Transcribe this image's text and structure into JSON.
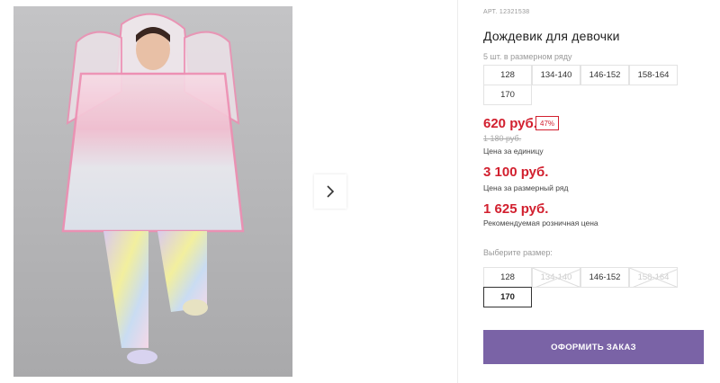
{
  "product": {
    "article": "АРТ. 12321538",
    "title": "Дождевик для девочки",
    "pack_note": "5 шт. в размерном ряду",
    "range_sizes": [
      "128",
      "134-140",
      "146-152",
      "158-164",
      "170"
    ],
    "price": "620 руб.",
    "discount": "47%",
    "old_price": "1 180 руб.",
    "price_caption": "Цена за единицу",
    "range_price": "3 100 руб.",
    "range_caption": "Цена за размерный ряд",
    "retail_price": "1 625 руб.",
    "retail_caption": "Рекомендуемая розничная цена",
    "choose_label": "Выберите размер:",
    "choose_sizes": [
      {
        "label": "128",
        "available": true,
        "selected": false
      },
      {
        "label": "134-140",
        "available": false,
        "selected": false
      },
      {
        "label": "146-152",
        "available": true,
        "selected": false
      },
      {
        "label": "158-164",
        "available": false,
        "selected": false
      },
      {
        "label": "170",
        "available": true,
        "selected": true
      }
    ],
    "order_button": "ОФОРМИТЬ ЗАКАЗ"
  },
  "gallery": {
    "next_icon": "chevron-right-icon",
    "photo": "girl-in-raincoat-photo"
  },
  "colors": {
    "price": "#d2202f",
    "order_button": "#7a63a6",
    "photo_bg": "#b9b9bb"
  }
}
